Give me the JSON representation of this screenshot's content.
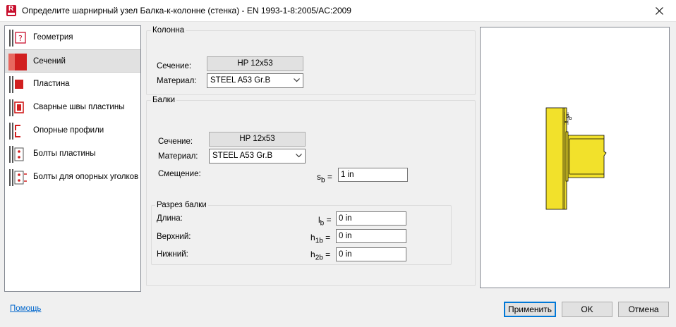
{
  "window": {
    "title": "Определите шарнирный узел Балка-к-колонне (стенка) - EN 1993-1-8:2005/AC:2009",
    "app_icon_letter": "R"
  },
  "sidebar": {
    "items": [
      {
        "label": "Геометрия",
        "icon": "geometry-icon"
      },
      {
        "label": "Сечений",
        "icon": "sections-icon",
        "selected": true
      },
      {
        "label": "Пластина",
        "icon": "plate-icon"
      },
      {
        "label": "Сварные швы пластины",
        "icon": "plate-welds-icon"
      },
      {
        "label": "Опорные профили",
        "icon": "support-profiles-icon"
      },
      {
        "label": "Болты пластины",
        "icon": "plate-bolts-icon"
      },
      {
        "label": "Болты для опорных уголков",
        "icon": "angle-bolts-icon"
      }
    ]
  },
  "column_group": {
    "title": "Колонна",
    "section_label": "Сечение:",
    "section_value": "HP 12x53",
    "material_label": "Материал:",
    "material_value": "STEEL A53 Gr.B"
  },
  "beams_group": {
    "title": "Балки",
    "section_label": "Сечение:",
    "section_value": "HP 12x53",
    "material_label": "Материал:",
    "material_value": "STEEL A53 Gr.B",
    "offset_label": "Смещение:",
    "offset_symbol": "s",
    "offset_sub": "b",
    "offset_value": "1 in"
  },
  "cut_group": {
    "title": "Разрез балки",
    "length_label": "Длина:",
    "length_symbol": "l",
    "length_sub": "b",
    "length_value": "0 in",
    "top_label": "Верхний:",
    "top_symbol": "h",
    "top_sub": "1b",
    "top_value": "0 in",
    "bottom_label": "Нижний:",
    "bottom_symbol": "h",
    "bottom_sub": "2b",
    "bottom_value": "0 in"
  },
  "preview": {
    "dimension_label": "s",
    "dimension_sub": "b",
    "member_color": "#f2e12b"
  },
  "footer": {
    "help_link": "Помощь",
    "apply_button": "Применить",
    "ok_button": "OK",
    "cancel_button": "Отмена"
  },
  "colors": {
    "accent": "#0078d7",
    "link": "#0066cc",
    "brand_red": "#c8102e"
  }
}
